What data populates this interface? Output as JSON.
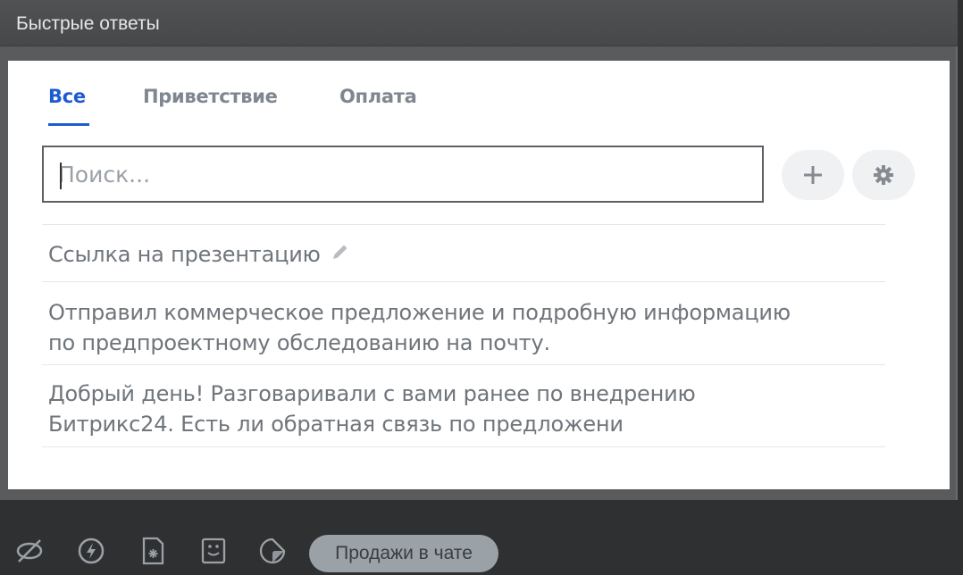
{
  "window": {
    "title": "Быстрые ответы"
  },
  "tabs": [
    {
      "label": "Все",
      "active": true
    },
    {
      "label": "Приветствие",
      "active": false
    },
    {
      "label": "Оплата",
      "active": false
    }
  ],
  "search": {
    "placeholder": "Поиск...",
    "value": ""
  },
  "actions": {
    "add_icon": "plus-icon",
    "settings_icon": "gear-icon"
  },
  "responses": [
    {
      "text": "Ссылка на презентацию",
      "icon": "pencil-icon"
    },
    {
      "line1": "Отправил коммерческое предложение и подробную информацию",
      "line2": "по предпроектному обследованию на почту."
    },
    {
      "line1": "Добрый день! Разговаривали с вами ранее по внедрению",
      "line2": "Битрикс24. Есть ли обратная связь по предложени"
    }
  ],
  "bottom_toolbar": {
    "icons": [
      "eye-off-icon",
      "lightning-icon",
      "file-icon",
      "form-icon",
      "sticker-icon"
    ],
    "sales_button_label": "Продажи в чате"
  },
  "colors": {
    "accent": "#1e5bcf",
    "tab_inactive": "#7f8790",
    "text": "#6f757b"
  }
}
